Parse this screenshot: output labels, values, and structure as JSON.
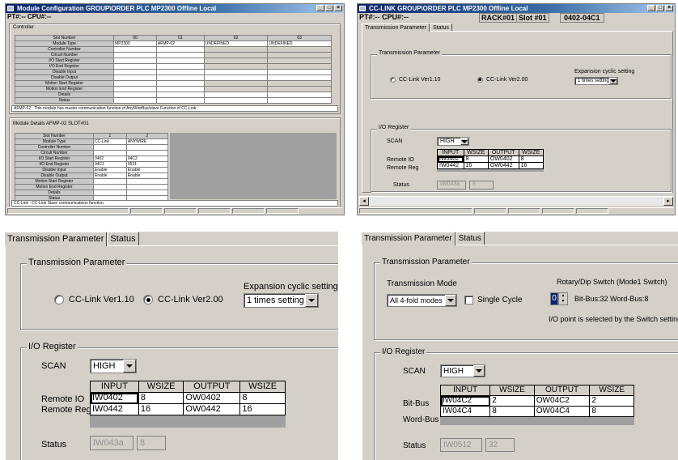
{
  "win1": {
    "title": "Module Configuration   GROUP\\ORDER  PLC  MP2300   Offline  Local",
    "menu": "PT#:--  CPU#:--",
    "controller": {
      "group_label": "Controller",
      "header": [
        "Slot Number",
        "00",
        "01",
        "02",
        "03"
      ],
      "row_labels": [
        "Module Type",
        "Controller Number",
        "Circuit Number",
        "I/O Start Register",
        "I/O End Register",
        "Disable Input",
        "Disable Output",
        "Motion Start Register",
        "Motion End Register",
        "Details",
        "Status"
      ],
      "module_types": [
        "MP2300",
        "AFMP-02",
        "UNDEFINED",
        "UNDEFINED"
      ],
      "note": "AFMP-02 : This module has master communication function of AnyWireBus/slave Function of CC-Link."
    },
    "details": {
      "group_label": "Module Details  AFMP-02  SLOT#01",
      "header": [
        "Slot Number",
        "1",
        "2"
      ],
      "row_labels": [
        "Module Type",
        "Controller Number",
        "Circuit Number",
        "I/O Start Register",
        "I/O End Register",
        "Disable Input",
        "Disable Output",
        "Motion Start Register",
        "Motion End Register",
        "Details",
        "Status"
      ],
      "col1": [
        "CC-Link",
        "",
        "",
        "0402",
        "04C1",
        "Enable",
        "Enable",
        "",
        "",
        "",
        ""
      ],
      "col2": [
        "ANYWIRE",
        "",
        "",
        "04C2",
        "0531",
        "Enable",
        "Enable",
        "",
        "",
        "",
        ""
      ],
      "note": "CC-Link : CC-Link Slave communications function."
    }
  },
  "win2": {
    "title": "CC-LINK   GROUP\\ORDER  PLC  MP2300   Offline  Local",
    "menu_left": "PT#:-- CPU#:--",
    "rack": "RACK#01",
    "slot": "Slot #01",
    "range": "0402-04C1",
    "tabs": [
      "Transmission Parameter",
      "Status"
    ],
    "trans_group": "Transmission Parameter",
    "radio1": "CC-Link Ver1.10",
    "radio2": "CC-Link Ver2.00",
    "exp_label": "Expansion cyclic setting",
    "exp_value": "1 times setting",
    "io_group": "I/O Register",
    "scan_label": "SCAN",
    "scan_value": "HIGH",
    "io_header": [
      "INPUT",
      "WSIZE",
      "OUTPUT",
      "WSIZE"
    ],
    "io_rows": [
      [
        "IW0402",
        "8",
        "OW0402",
        "8"
      ],
      [
        "IW0442",
        "16",
        "OW0442",
        "16"
      ]
    ],
    "row_label1": "Remote IO",
    "row_label2": "Remote Reg",
    "status_label": "Status",
    "status_val1": "IW043a",
    "status_val2": "8"
  },
  "cc": {
    "tabs": [
      "Transmission Parameter",
      "Status"
    ],
    "trans_group": "Transmission Parameter",
    "radio1": "CC-Link Ver1.10",
    "radio2": "CC-Link Ver2.00",
    "exp_label": "Expansion cyclic setting",
    "exp_value": "1 times setting",
    "io_group": "I/O Register",
    "scan_label": "SCAN",
    "scan_value": "HIGH",
    "io_header": [
      "INPUT",
      "WSIZE",
      "OUTPUT",
      "WSIZE"
    ],
    "io_rows": [
      [
        "IW0402",
        "8",
        "OW0402",
        "8"
      ],
      [
        "IW0442",
        "16",
        "OW0442",
        "16"
      ]
    ],
    "row_label1": "Remote IO",
    "row_label2": "Remote Reg",
    "status_label": "Status",
    "status_val1": "IW043a",
    "status_val2": "8"
  },
  "aw": {
    "tabs": [
      "Transmission Parameter",
      "Status"
    ],
    "trans_group": "Transmission Parameter",
    "mode_label": "Transmission Mode",
    "mode_value": "All 4-fold modes",
    "single_cycle": "Single Cycle",
    "rotary_label": "Rotary/Dip Switch (Mode1 Switch)",
    "switch_value": "0",
    "bus_info": "Bit-Bus:32  Word-Bus:8",
    "note": "I/O point is selected by the Switch setting.",
    "io_group": "I/O Register",
    "scan_label": "SCAN",
    "scan_value": "HIGH",
    "io_header": [
      "INPUT",
      "WSIZE",
      "OUTPUT",
      "WSIZE"
    ],
    "io_rows": [
      [
        "IW04C2",
        "2",
        "OW04C2",
        "2"
      ],
      [
        "IW04C4",
        "8",
        "OW04C4",
        "8"
      ]
    ],
    "row_label1": "Bit-Bus",
    "row_label2": "Word-Bus",
    "status_label": "Status",
    "status_val1": "IW0512",
    "status_val2": "32"
  }
}
